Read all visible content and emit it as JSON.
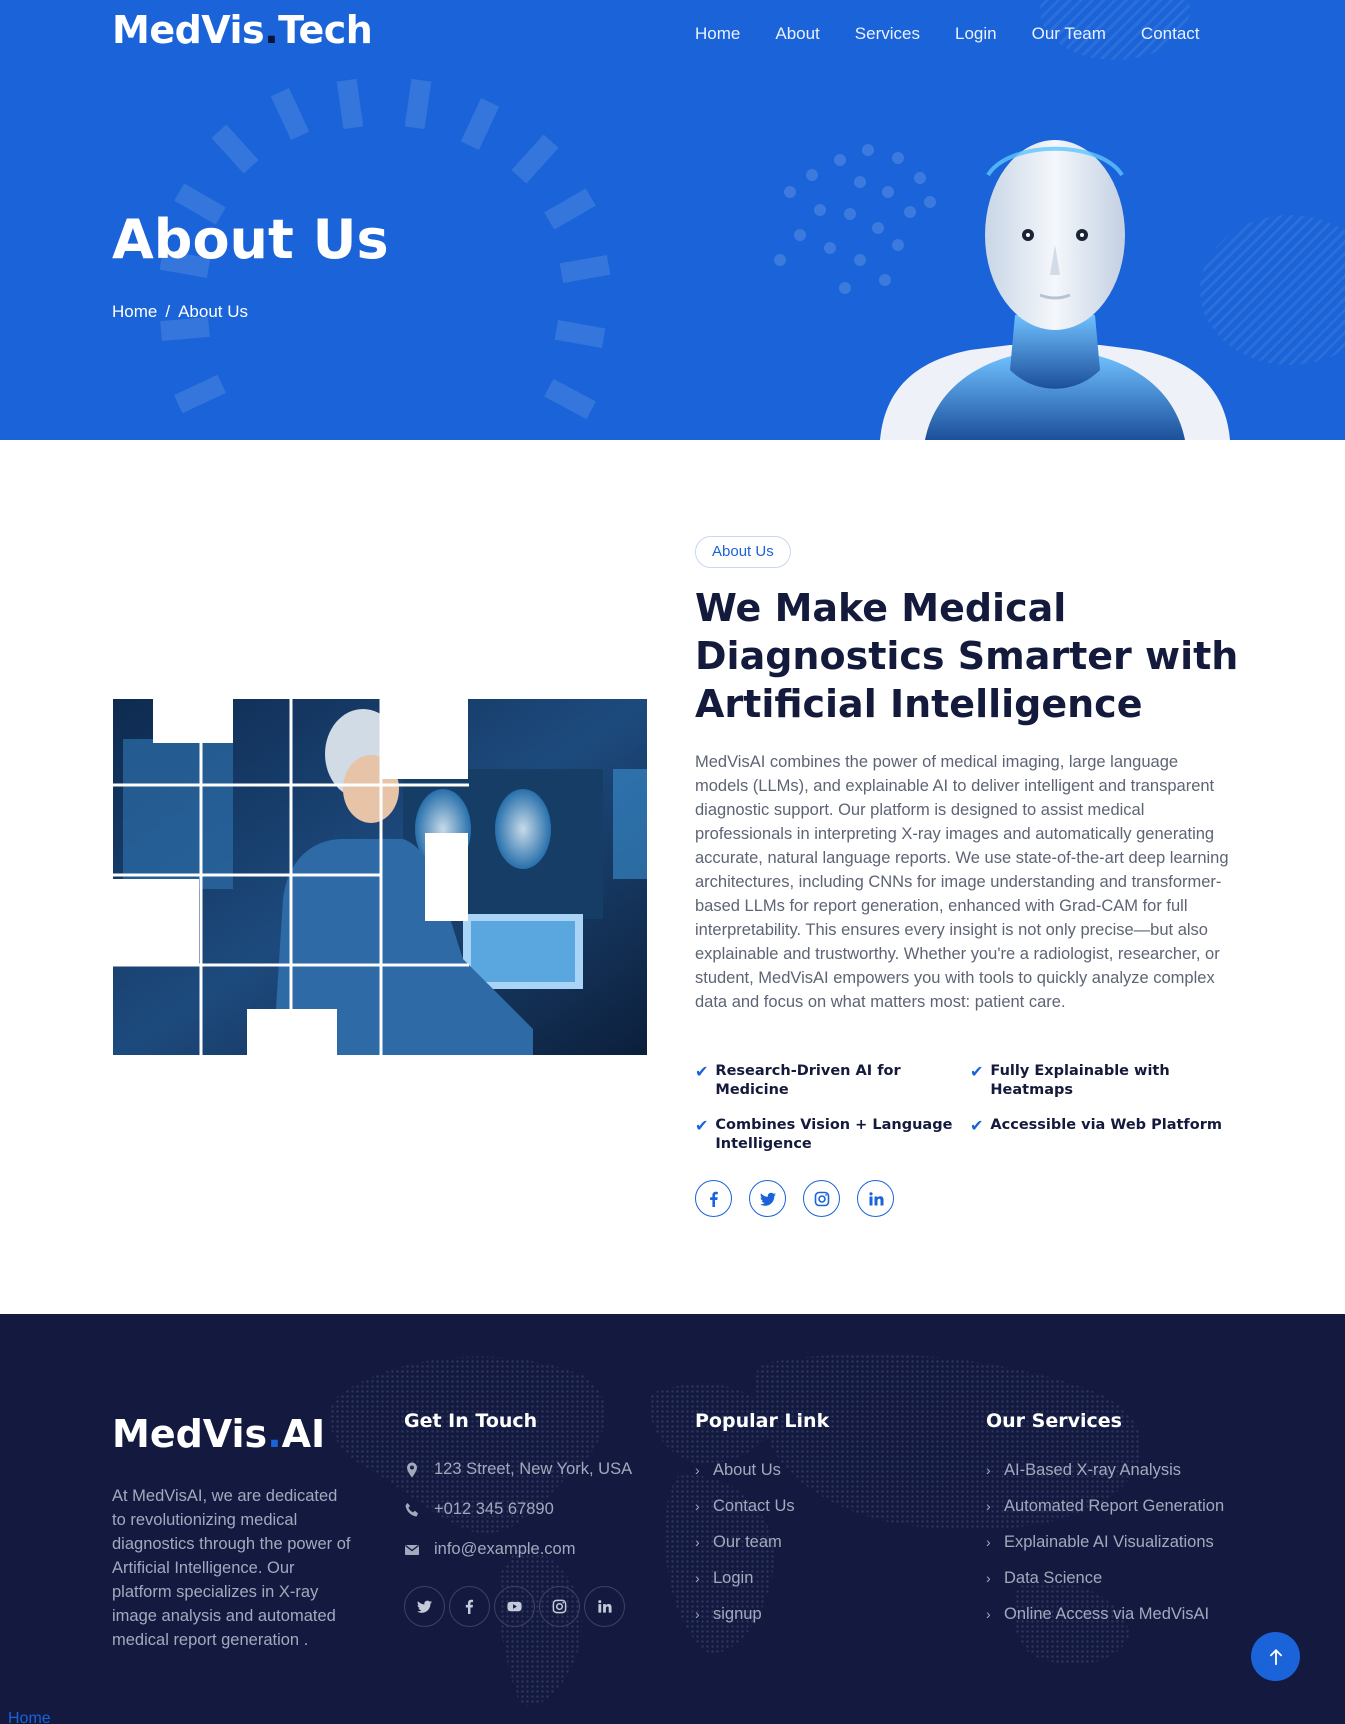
{
  "brand": {
    "name_part1": "MedVis",
    "name_dot": ".",
    "name_part2": "Tech"
  },
  "nav": [
    {
      "label": "Home"
    },
    {
      "label": "About"
    },
    {
      "label": "Services"
    },
    {
      "label": "Login"
    },
    {
      "label": "Our Team"
    },
    {
      "label": "Contact"
    }
  ],
  "hero": {
    "title": "About Us",
    "breadcrumb": {
      "home": "Home",
      "separator": "/",
      "current": "About Us"
    }
  },
  "about": {
    "tag": "About Us",
    "heading": "We Make Medical Diagnostics Smarter with Artificial Intelligence",
    "paragraph": "MedVisAI combines the power of medical imaging, large language models (LLMs), and explainable AI to deliver intelligent and transparent diagnostic support. Our platform is designed to assist medical professionals in interpreting X-ray images and automatically generating accurate, natural language reports. We use state-of-the-art deep learning architectures, including CNNs for image understanding and transformer-based LLMs for report generation, enhanced with Grad-CAM for full interpretability. This ensures every insight is not only precise—but also explainable and trustworthy. Whether you're a radiologist, researcher, or student, MedVisAI empowers you with tools to quickly analyze complex data and focus on what matters most: patient care.",
    "features": [
      {
        "label": "Research-Driven AI for Medicine"
      },
      {
        "label": "Fully Explainable with Heatmaps"
      },
      {
        "label": "Combines Vision + Language Intelligence"
      },
      {
        "label": "Accessible via Web Platform"
      }
    ],
    "socials": [
      "facebook-icon",
      "twitter-icon",
      "instagram-icon",
      "linkedin-icon"
    ]
  },
  "footer": {
    "brand": {
      "name_part1": "MedVis",
      "name_dot": ".",
      "name_part2": "AI"
    },
    "description": "At MedVisAI, we are dedicated to revolutionizing medical diagnostics through the power of Artificial Intelligence. Our platform specializes in X-ray image analysis and automated medical report generation .",
    "get_in_touch": {
      "title": "Get In Touch",
      "address": "123 Street, New York, USA",
      "phone": "+012 345 67890",
      "email": "info@example.com"
    },
    "socials": [
      "twitter-icon",
      "facebook-icon",
      "youtube-icon",
      "instagram-icon",
      "linkedin-icon"
    ],
    "popular_link": {
      "title": "Popular Link",
      "items": [
        {
          "label": "About Us"
        },
        {
          "label": "Contact Us"
        },
        {
          "label": "Our team"
        },
        {
          "label": "Login"
        },
        {
          "label": "signup"
        }
      ]
    },
    "our_services": {
      "title": "Our Services",
      "items": [
        {
          "label": "AI-Based X-ray Analysis"
        },
        {
          "label": "Automated Report Generation"
        },
        {
          "label": "Explainable AI Visualizations"
        },
        {
          "label": "Data Science"
        },
        {
          "label": "Online Access via MedVisAI"
        }
      ]
    }
  },
  "bottom_link": "Home",
  "colors": {
    "primary": "#1a63d8",
    "dark": "#141a3c",
    "footer_bg": "#141a3f"
  }
}
